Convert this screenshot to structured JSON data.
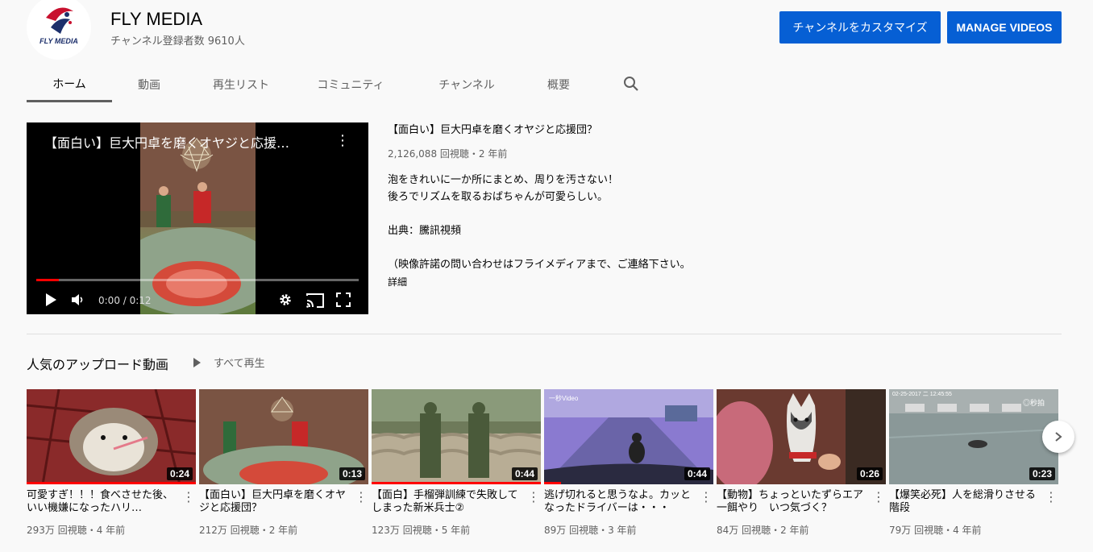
{
  "channel": {
    "name": "FLY MEDIA",
    "avatar_text": "FLY MEDIA",
    "subscribers": "チャンネル登録者数 9610人"
  },
  "buttons": {
    "customize": "チャンネルをカスタマイズ",
    "manage": "MANAGE VIDEOS"
  },
  "tabs": [
    {
      "label": "ホーム",
      "active": true
    },
    {
      "label": "動画"
    },
    {
      "label": "再生リスト"
    },
    {
      "label": "コミュニティ"
    },
    {
      "label": "チャンネル"
    },
    {
      "label": "概要"
    }
  ],
  "icons": {
    "search": "search-icon",
    "play": "play-icon",
    "volume": "volume-icon",
    "settings": "gear-icon",
    "cast": "cast-icon",
    "fullscreen": "fullscreen-icon",
    "more": "more-vert-icon",
    "next": "chevron-right-icon"
  },
  "featured": {
    "player_title": "【面白い】巨大円卓を磨くオヤジと応援…",
    "time": "0:00 / 0:12",
    "progress": 0.07,
    "title": "【面白い】巨大円卓を磨くオヤジと応援団？",
    "meta": "2,126,088 回視聴・2 年前",
    "description": "泡をきれいに一か所にまとめ、周りを汚さない！\n後ろでリズムを取るおばちゃんが可愛らしい。\n\n出典：騰訊視頻\n\n（映像許諾の問い合わせはフライメディアまで、ご連絡下さい。",
    "more": "詳細"
  },
  "shelf": {
    "title": "人気のアップロード動画",
    "play_all": "すべて再生"
  },
  "videos": [
    {
      "title": "可愛すぎ！！！食べさせた後、いい機嫌になったハリ…",
      "duration": "0:24",
      "meta": "293万 回視聴・4 年前",
      "watched": 1.0
    },
    {
      "title": "【面白い】巨大円卓を磨くオヤジと応援団？",
      "duration": "0:13",
      "meta": "212万 回視聴・2 年前",
      "watched": 0
    },
    {
      "title": "【面白】手榴弾訓練で失敗してしまった新米兵士②",
      "duration": "0:44",
      "meta": "123万 回視聴・5 年前",
      "watched": 1.0
    },
    {
      "title": "逃げ切れると思うなよ。カッとなったドライバーは・・・",
      "duration": "0:44",
      "meta": "89万 回視聴・3 年前",
      "watched": 0.1
    },
    {
      "title": "【動物】ちょっといたずらエア一餌やり　いつ気づく？",
      "duration": "0:26",
      "meta": "84万 回視聴・2 年前",
      "watched": 0
    },
    {
      "title": "【爆笑必死】人を総滑りさせる階段",
      "duration": "0:23",
      "meta": "79万 回視聴・4 年前",
      "watched": 0
    }
  ],
  "thumb_text": {
    "t6_timestamp": "02-25-2017 二 12:45:55",
    "t6_logo": "◎秒拍",
    "t4_logo": "一秒Video"
  }
}
